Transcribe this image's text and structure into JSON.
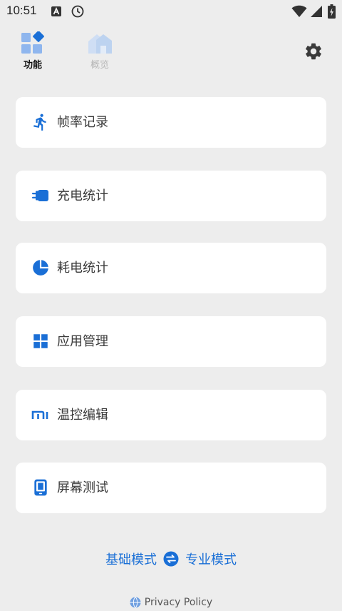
{
  "status_bar": {
    "time": "10:51",
    "notification_icons": [
      "a-letter-icon",
      "clock-icon"
    ],
    "system_icons": [
      "wifi-icon",
      "cell-signal-icon",
      "battery-icon"
    ]
  },
  "nav": {
    "tabs": [
      {
        "label": "功能",
        "icon": "grid-diamond-icon",
        "active": true
      },
      {
        "label": "概览",
        "icon": "house-icon",
        "active": false
      }
    ],
    "settings_icon": "gear-icon"
  },
  "menu": {
    "items": [
      {
        "label": "帧率记录",
        "icon": "running-person-icon"
      },
      {
        "label": "充电统计",
        "icon": "charging-plug-icon"
      },
      {
        "label": "耗电统计",
        "icon": "pie-chart-icon"
      },
      {
        "label": "应用管理",
        "icon": "app-grid-icon"
      },
      {
        "label": "温控编辑",
        "icon": "mi-logo-icon"
      },
      {
        "label": "屏幕测试",
        "icon": "phone-screen-icon"
      }
    ]
  },
  "mode_switch": {
    "basic_label": "基础模式",
    "pro_label": "专业模式",
    "icon": "swap-arrows-icon"
  },
  "privacy": {
    "label": "Privacy Policy",
    "icon": "globe-icon"
  },
  "colors": {
    "accent": "#1a6fd6",
    "background": "#ededed",
    "card": "#ffffff",
    "inactive_tab": "#b5b5b5"
  }
}
